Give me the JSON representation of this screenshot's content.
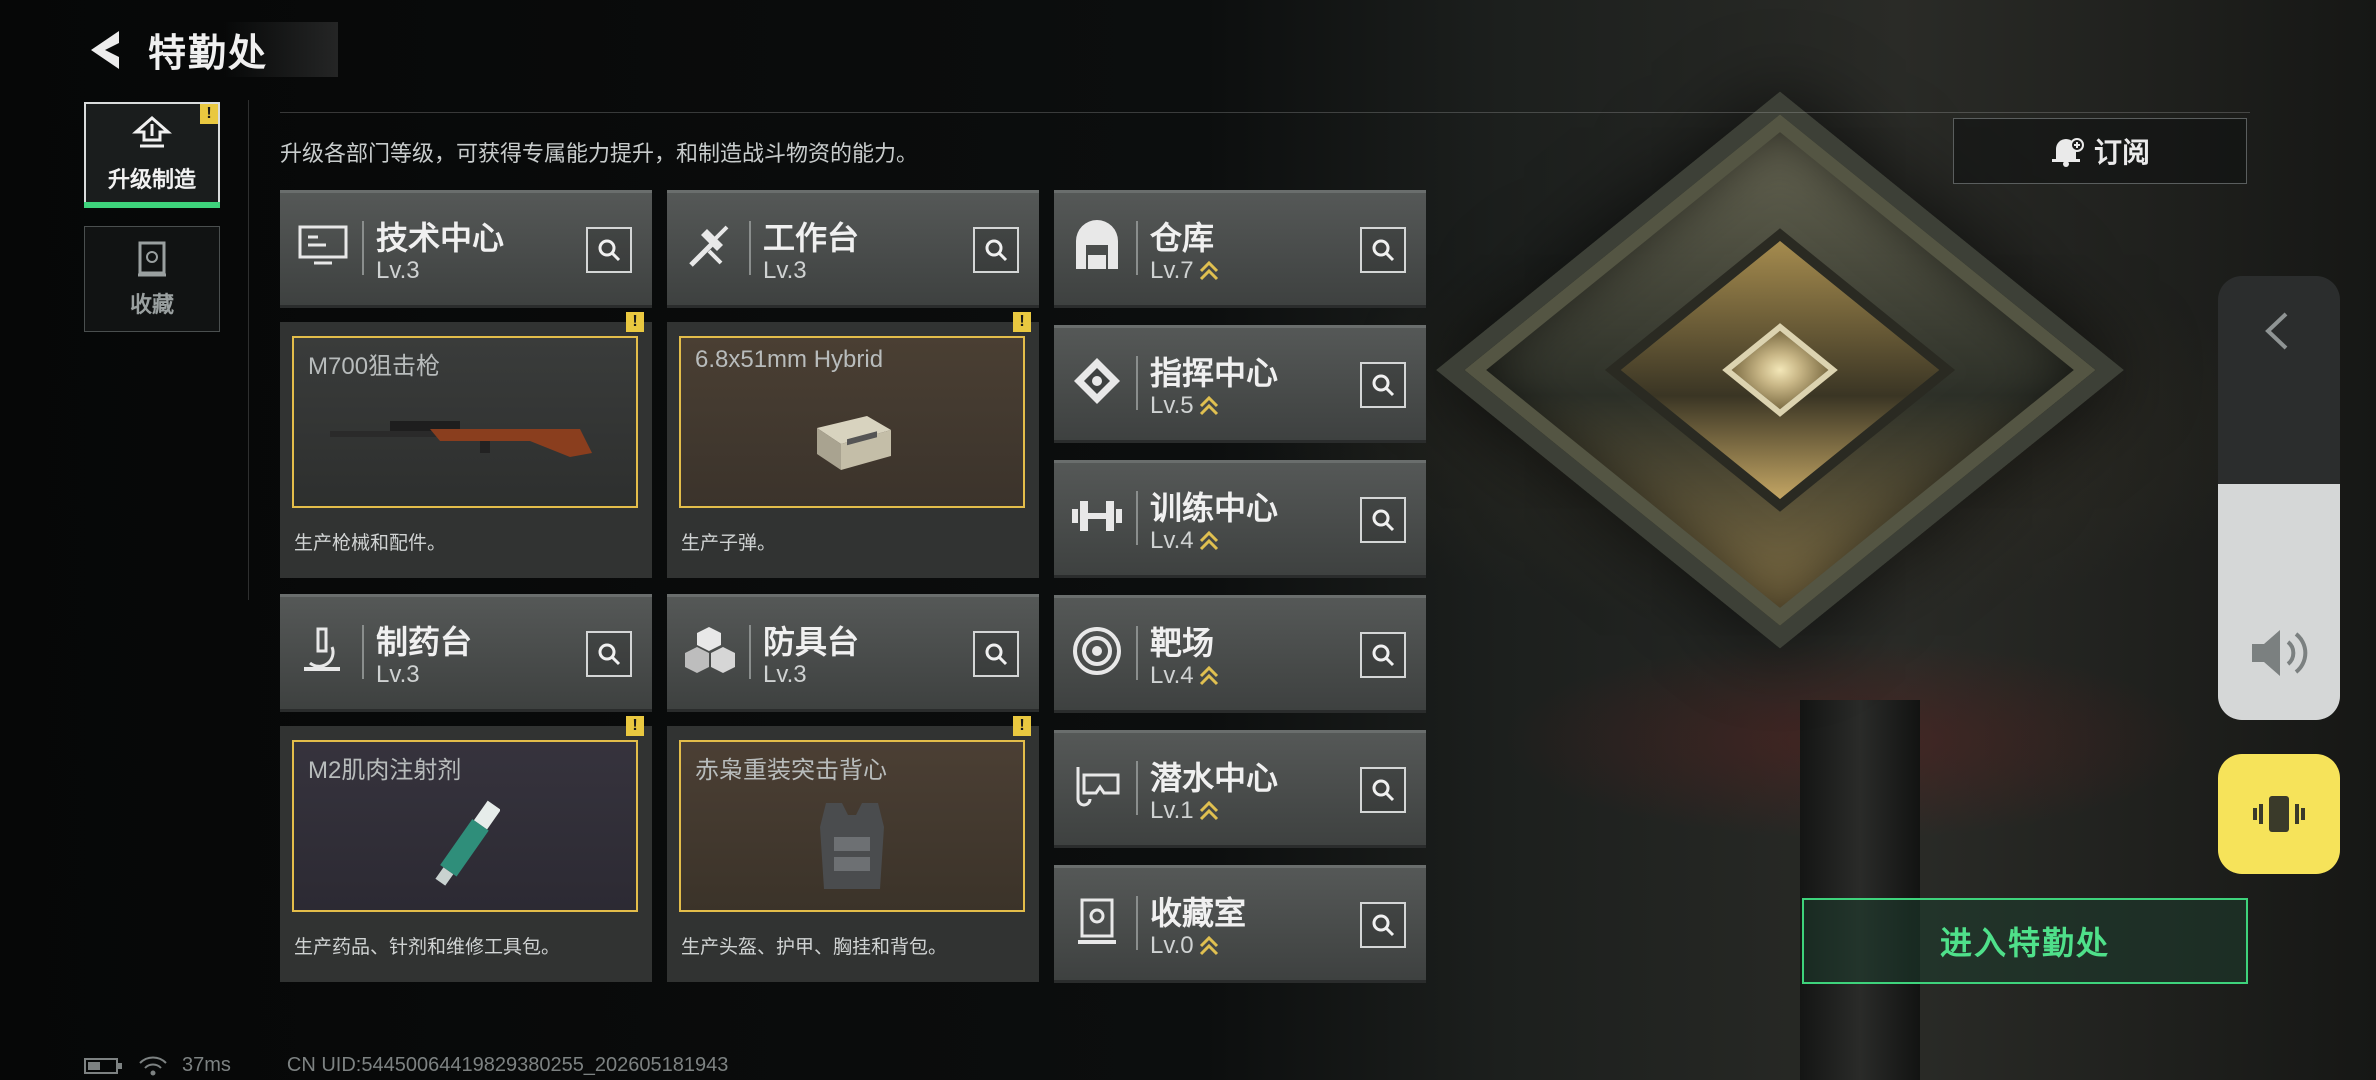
{
  "header": {
    "title": "特勤处"
  },
  "nav": [
    {
      "label": "升级制造",
      "active": true,
      "alert": "!"
    },
    {
      "label": "收藏",
      "active": false
    }
  ],
  "description": "升级各部门等级，可获得专属能力提升，和制造战斗物资的能力。",
  "subscribe_label": "订阅",
  "departments_left": [
    {
      "name": "技术中心",
      "level": "Lv.3",
      "icon": "computer-icon",
      "product": {
        "item": "M700狙击枪",
        "desc": "生产枪械和配件。",
        "alert": "!"
      }
    },
    {
      "name": "工作台",
      "level": "Lv.3",
      "icon": "tools-icon",
      "product": {
        "item": "6.8x51mm Hybrid",
        "desc": "生产子弹。",
        "alert": "!"
      }
    },
    {
      "name": "制药台",
      "level": "Lv.3",
      "icon": "microscope-icon",
      "product": {
        "item": "M2肌肉注射剂",
        "desc": "生产药品、针剂和维修工具包。",
        "alert": "!"
      }
    },
    {
      "name": "防具台",
      "level": "Lv.3",
      "icon": "armor-blocks-icon",
      "product": {
        "item": "赤枭重装突击背心",
        "desc": "生产头盔、护甲、胸挂和背包。",
        "alert": "!"
      }
    }
  ],
  "departments_right": [
    {
      "name": "仓库",
      "level": "Lv.7",
      "icon": "warehouse-icon"
    },
    {
      "name": "指挥中心",
      "level": "Lv.5",
      "icon": "chip-icon"
    },
    {
      "name": "训练中心",
      "level": "Lv.4",
      "icon": "dumbbell-icon"
    },
    {
      "name": "靶场",
      "level": "Lv.4",
      "icon": "target-icon"
    },
    {
      "name": "潜水中心",
      "level": "Lv.1",
      "icon": "dive-mask-icon"
    },
    {
      "name": "收藏室",
      "level": "Lv.0",
      "icon": "trophy-case-icon"
    }
  ],
  "enter_button": "进入特勤处",
  "status": {
    "ping": "37ms",
    "uid": "CN UID:544500644198293802­55_202605181943"
  },
  "colors": {
    "accent_green": "#3ed37c",
    "alert_yellow": "#e9c840",
    "frame_gold": "#e3bd4a"
  }
}
